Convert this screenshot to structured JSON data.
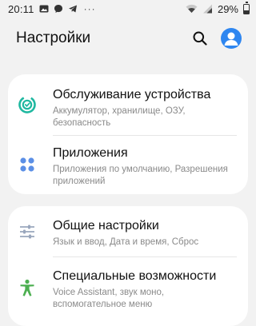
{
  "status_bar": {
    "time": "20:11",
    "battery_percent": "29%",
    "battery_level": 0.29,
    "icons": [
      "image-icon",
      "messenger-icon",
      "telegram-icon",
      "more-dots",
      "wifi-icon",
      "signal-icon",
      "battery-icon"
    ],
    "more": "···"
  },
  "header": {
    "title": "Настройки",
    "search_icon": "search-icon",
    "avatar_icon": "account-icon",
    "avatar_color": "#2e86f0"
  },
  "groups": [
    {
      "items": [
        {
          "title": "Обслуживание устройства",
          "subtitle": "Аккумулятор, хранилище, ОЗУ, безопасность",
          "icon": "device-care-icon",
          "icon_color": "#1fb8a0"
        },
        {
          "title": "Приложения",
          "subtitle": "Приложения по умолчанию, Разрешения приложений",
          "icon": "apps-icon",
          "icon_color": "#5b8fe6"
        }
      ]
    },
    {
      "items": [
        {
          "title": "Общие настройки",
          "subtitle": "Язык и ввод, Дата и время, Сброс",
          "icon": "sliders-icon",
          "icon_color": "#9aa7bd"
        },
        {
          "title": "Специальные возможности",
          "subtitle": "Voice Assistant, звук моно, вспомогательное меню",
          "icon": "accessibility-icon",
          "icon_color": "#4caf50"
        }
      ]
    }
  ]
}
